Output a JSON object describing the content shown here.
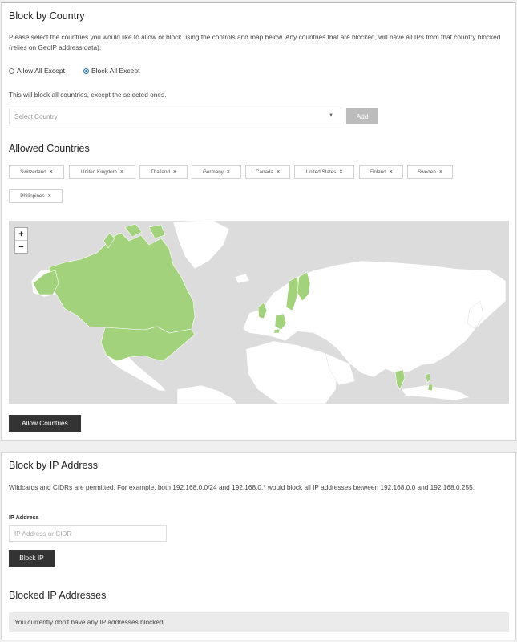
{
  "country_section": {
    "title": "Block by Country",
    "description": "Please select the countries you would like to allow or block using the controls and map below. Any countries that are blocked, will have all IPs from that country blocked (relies on GeoIP address data).",
    "radio_allow": "Allow All Except",
    "radio_block": "Block All Except",
    "selected_mode": "Block All Except",
    "mode_hint": "This will block all countries, except the selected ones.",
    "select_placeholder": "Select Country",
    "add_button": "Add",
    "allowed_title": "Allowed Countries",
    "countries": [
      "Switzerland",
      "United Kingdom",
      "Thailand",
      "Germany",
      "Canada",
      "United States",
      "Finland",
      "Sweden",
      "Philippines"
    ],
    "remove_symbol": "×",
    "zoom_in": "+",
    "zoom_out": "−",
    "allow_button": "Allow Countries",
    "map_highlight_color": "#a3d27c",
    "map_land_color": "#ffffff",
    "map_water_color": "#dcdcdc"
  },
  "ip_section": {
    "title": "Block by IP Address",
    "description": "Wildcards and CIDRs are permitted. For example, both 192.168.0.0/24 and 192.168.0.* would block all IP addresses between 192.168.0.0 and 192.168.0.255.",
    "field_label": "IP Address",
    "field_placeholder": "IP Address or CIDR",
    "block_button": "Block IP",
    "blocked_title": "Blocked IP Addresses",
    "empty_notice": "You currently don't have any IP addresses blocked."
  }
}
